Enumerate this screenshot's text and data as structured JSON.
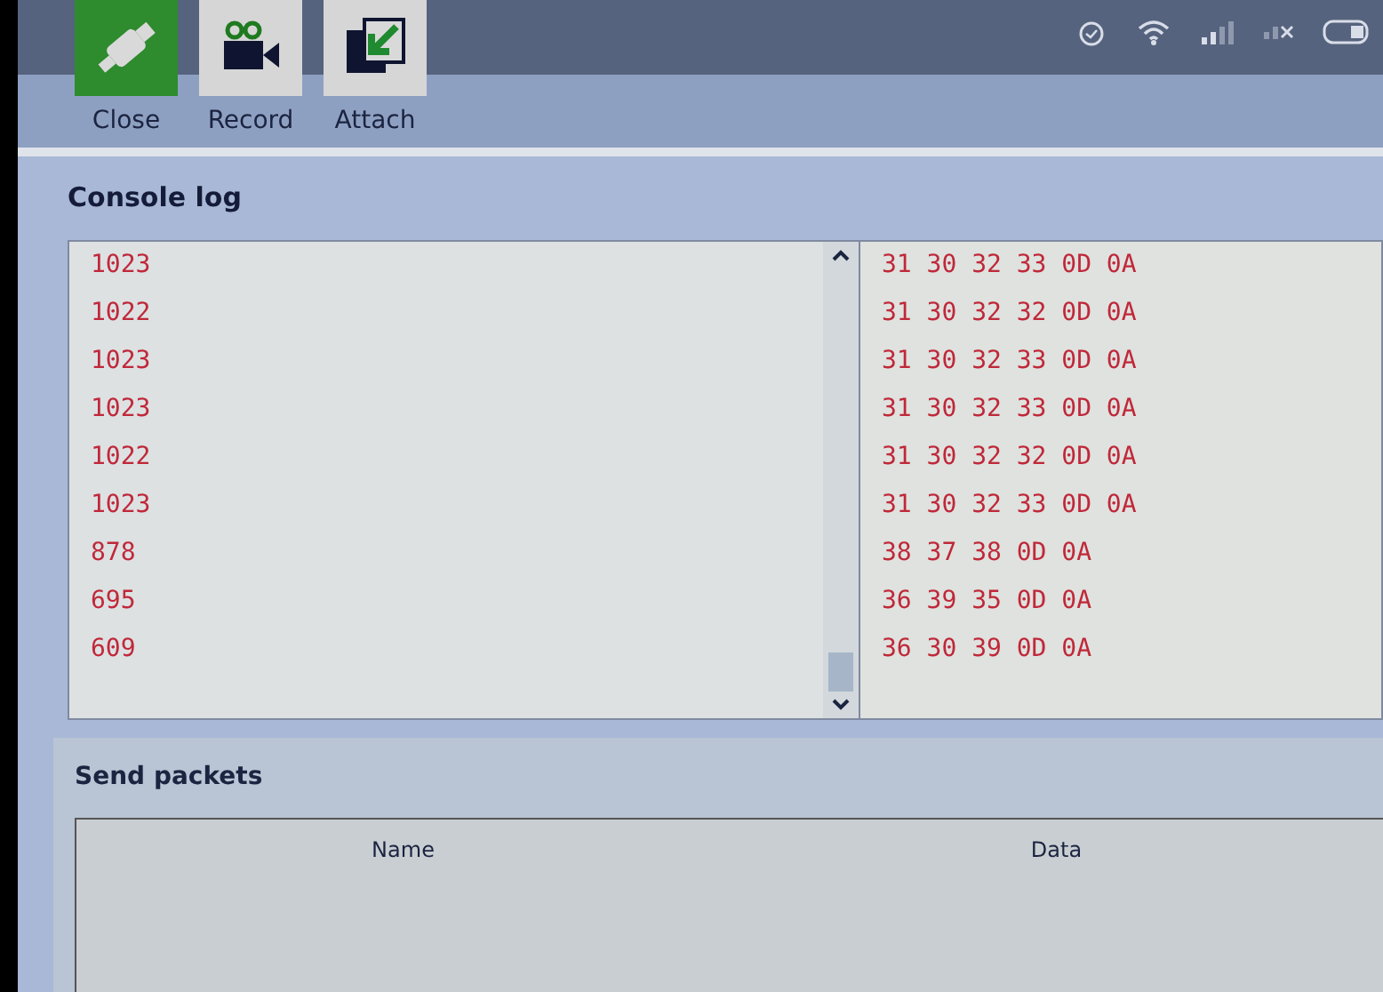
{
  "toolbar": [
    {
      "kind": "close",
      "label": "Close"
    },
    {
      "kind": "record",
      "label": "Record"
    },
    {
      "kind": "attach",
      "label": "Attach"
    }
  ],
  "console_log": {
    "title": "Console log",
    "values": [
      "1023",
      "1022",
      "1023",
      "1023",
      "1022",
      "1023",
      "878",
      "695",
      "609"
    ],
    "hex": [
      "31 30 32 33 0D 0A",
      "31 30 32 32 0D 0A",
      "31 30 32 33 0D 0A",
      "31 30 32 33 0D 0A",
      "31 30 32 32 0D 0A",
      "31 30 32 33 0D 0A",
      "38 37 38 0D 0A",
      "36 39 35 0D 0A",
      "36 30 39 0D 0A"
    ]
  },
  "send_packets": {
    "title": "Send packets",
    "columns": [
      "Name",
      "Data"
    ]
  }
}
